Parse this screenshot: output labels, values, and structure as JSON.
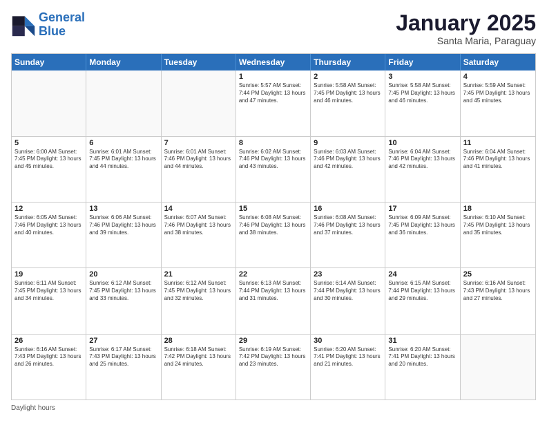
{
  "header": {
    "logo_line1": "General",
    "logo_line2": "Blue",
    "month": "January 2025",
    "location": "Santa Maria, Paraguay"
  },
  "days_of_week": [
    "Sunday",
    "Monday",
    "Tuesday",
    "Wednesday",
    "Thursday",
    "Friday",
    "Saturday"
  ],
  "weeks": [
    [
      {
        "day": "",
        "text": ""
      },
      {
        "day": "",
        "text": ""
      },
      {
        "day": "",
        "text": ""
      },
      {
        "day": "1",
        "text": "Sunrise: 5:57 AM\nSunset: 7:44 PM\nDaylight: 13 hours and 47 minutes."
      },
      {
        "day": "2",
        "text": "Sunrise: 5:58 AM\nSunset: 7:45 PM\nDaylight: 13 hours and 46 minutes."
      },
      {
        "day": "3",
        "text": "Sunrise: 5:58 AM\nSunset: 7:45 PM\nDaylight: 13 hours and 46 minutes."
      },
      {
        "day": "4",
        "text": "Sunrise: 5:59 AM\nSunset: 7:45 PM\nDaylight: 13 hours and 45 minutes."
      }
    ],
    [
      {
        "day": "5",
        "text": "Sunrise: 6:00 AM\nSunset: 7:45 PM\nDaylight: 13 hours and 45 minutes."
      },
      {
        "day": "6",
        "text": "Sunrise: 6:01 AM\nSunset: 7:45 PM\nDaylight: 13 hours and 44 minutes."
      },
      {
        "day": "7",
        "text": "Sunrise: 6:01 AM\nSunset: 7:46 PM\nDaylight: 13 hours and 44 minutes."
      },
      {
        "day": "8",
        "text": "Sunrise: 6:02 AM\nSunset: 7:46 PM\nDaylight: 13 hours and 43 minutes."
      },
      {
        "day": "9",
        "text": "Sunrise: 6:03 AM\nSunset: 7:46 PM\nDaylight: 13 hours and 42 minutes."
      },
      {
        "day": "10",
        "text": "Sunrise: 6:04 AM\nSunset: 7:46 PM\nDaylight: 13 hours and 42 minutes."
      },
      {
        "day": "11",
        "text": "Sunrise: 6:04 AM\nSunset: 7:46 PM\nDaylight: 13 hours and 41 minutes."
      }
    ],
    [
      {
        "day": "12",
        "text": "Sunrise: 6:05 AM\nSunset: 7:46 PM\nDaylight: 13 hours and 40 minutes."
      },
      {
        "day": "13",
        "text": "Sunrise: 6:06 AM\nSunset: 7:46 PM\nDaylight: 13 hours and 39 minutes."
      },
      {
        "day": "14",
        "text": "Sunrise: 6:07 AM\nSunset: 7:46 PM\nDaylight: 13 hours and 38 minutes."
      },
      {
        "day": "15",
        "text": "Sunrise: 6:08 AM\nSunset: 7:46 PM\nDaylight: 13 hours and 38 minutes."
      },
      {
        "day": "16",
        "text": "Sunrise: 6:08 AM\nSunset: 7:46 PM\nDaylight: 13 hours and 37 minutes."
      },
      {
        "day": "17",
        "text": "Sunrise: 6:09 AM\nSunset: 7:45 PM\nDaylight: 13 hours and 36 minutes."
      },
      {
        "day": "18",
        "text": "Sunrise: 6:10 AM\nSunset: 7:45 PM\nDaylight: 13 hours and 35 minutes."
      }
    ],
    [
      {
        "day": "19",
        "text": "Sunrise: 6:11 AM\nSunset: 7:45 PM\nDaylight: 13 hours and 34 minutes."
      },
      {
        "day": "20",
        "text": "Sunrise: 6:12 AM\nSunset: 7:45 PM\nDaylight: 13 hours and 33 minutes."
      },
      {
        "day": "21",
        "text": "Sunrise: 6:12 AM\nSunset: 7:45 PM\nDaylight: 13 hours and 32 minutes."
      },
      {
        "day": "22",
        "text": "Sunrise: 6:13 AM\nSunset: 7:44 PM\nDaylight: 13 hours and 31 minutes."
      },
      {
        "day": "23",
        "text": "Sunrise: 6:14 AM\nSunset: 7:44 PM\nDaylight: 13 hours and 30 minutes."
      },
      {
        "day": "24",
        "text": "Sunrise: 6:15 AM\nSunset: 7:44 PM\nDaylight: 13 hours and 29 minutes."
      },
      {
        "day": "25",
        "text": "Sunrise: 6:16 AM\nSunset: 7:43 PM\nDaylight: 13 hours and 27 minutes."
      }
    ],
    [
      {
        "day": "26",
        "text": "Sunrise: 6:16 AM\nSunset: 7:43 PM\nDaylight: 13 hours and 26 minutes."
      },
      {
        "day": "27",
        "text": "Sunrise: 6:17 AM\nSunset: 7:43 PM\nDaylight: 13 hours and 25 minutes."
      },
      {
        "day": "28",
        "text": "Sunrise: 6:18 AM\nSunset: 7:42 PM\nDaylight: 13 hours and 24 minutes."
      },
      {
        "day": "29",
        "text": "Sunrise: 6:19 AM\nSunset: 7:42 PM\nDaylight: 13 hours and 23 minutes."
      },
      {
        "day": "30",
        "text": "Sunrise: 6:20 AM\nSunset: 7:41 PM\nDaylight: 13 hours and 21 minutes."
      },
      {
        "day": "31",
        "text": "Sunrise: 6:20 AM\nSunset: 7:41 PM\nDaylight: 13 hours and 20 minutes."
      },
      {
        "day": "",
        "text": ""
      }
    ]
  ],
  "footer": {
    "note": "Daylight hours"
  }
}
